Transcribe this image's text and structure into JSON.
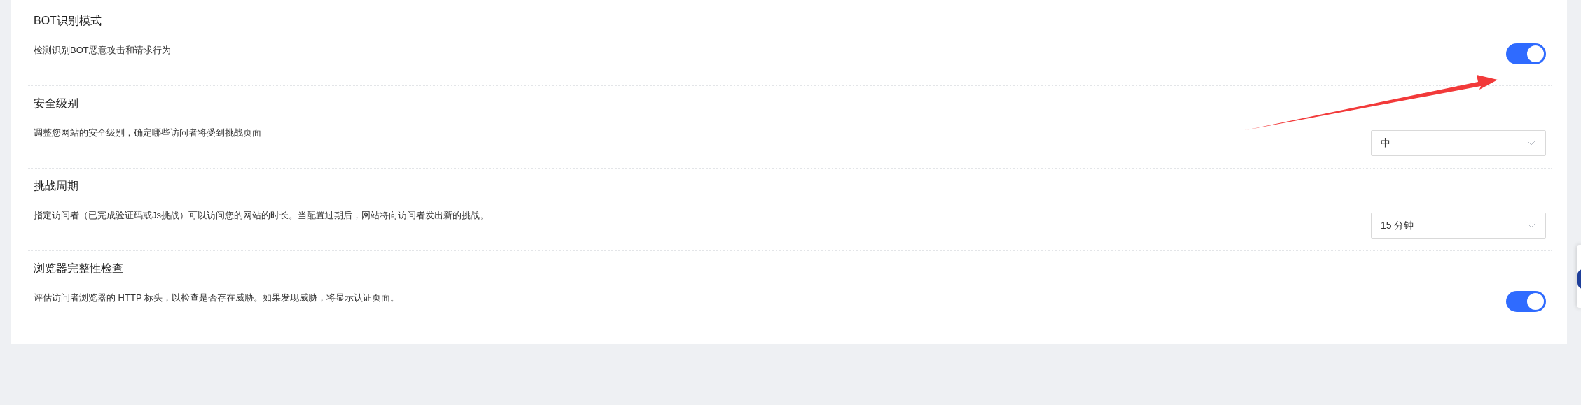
{
  "sections": [
    {
      "title": "BOT识别模式",
      "description": "检测识别BOT恶意攻击和请求行为",
      "control": {
        "kind": "toggle",
        "on": true
      }
    },
    {
      "title": "安全级别",
      "description": "调整您网站的安全级别，确定哪些访问者将受到挑战页面",
      "control": {
        "kind": "select",
        "value": "中"
      }
    },
    {
      "title": "挑战周期",
      "description": "指定访问者（已完成验证码或Js挑战）可以访问您的网站的时长。当配置过期后，网站将向访问者发出新的挑战。",
      "control": {
        "kind": "select",
        "value": "15 分钟"
      }
    },
    {
      "title": "浏览器完整性检查",
      "description": "评估访问者浏览器的 HTTP 标头，以检查是否存在威胁。如果发现威胁，将显示认证页面。",
      "control": {
        "kind": "toggle",
        "on": true
      }
    }
  ]
}
